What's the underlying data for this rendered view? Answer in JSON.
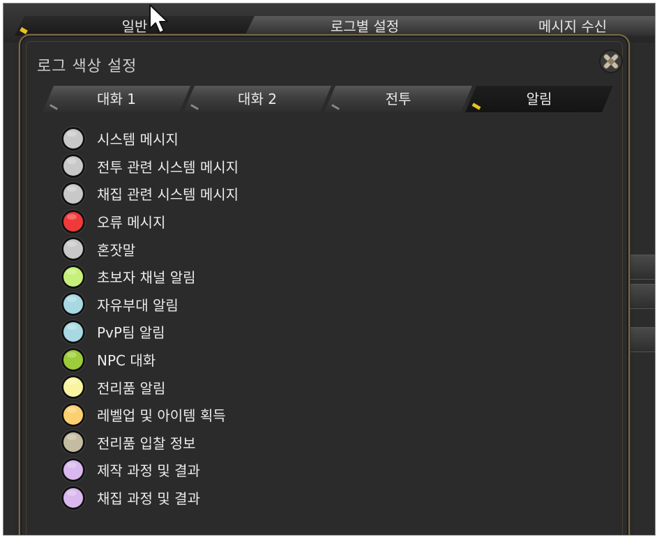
{
  "background_window": {
    "tabs": [
      {
        "label": "일반",
        "active": true
      },
      {
        "label": "로그별 설정",
        "active": false
      },
      {
        "label": "메시지 수신",
        "active": false
      }
    ]
  },
  "dialog": {
    "title": "로그 색상 설정",
    "close_icon": "close-icon",
    "tabs": [
      {
        "label": "대화 1",
        "active": false
      },
      {
        "label": "대화 2",
        "active": false
      },
      {
        "label": "전투",
        "active": false
      },
      {
        "label": "알림",
        "active": true
      }
    ],
    "items": [
      {
        "label": "시스템 메시지",
        "color": "#c8c8c8"
      },
      {
        "label": "전투 관련 시스템 메시지",
        "color": "#c8c8c8"
      },
      {
        "label": "채집 관련 시스템 메시지",
        "color": "#c8c8c8"
      },
      {
        "label": "오류 메시지",
        "color": "#f03a3a"
      },
      {
        "label": "혼잣말",
        "color": "#c8c8c8"
      },
      {
        "label": "초보자 채널 알림",
        "color": "#c6f07a"
      },
      {
        "label": "자유부대 알림",
        "color": "#a8d8e2"
      },
      {
        "label": "PvP팀 알림",
        "color": "#a8d8e2"
      },
      {
        "label": "NPC 대화",
        "color": "#9ccc3a"
      },
      {
        "label": "전리품 알림",
        "color": "#f8f4a0"
      },
      {
        "label": "레벨업 및 아이템 획득",
        "color": "#fcd070"
      },
      {
        "label": "전리품 입찰 정보",
        "color": "#c4bca0"
      },
      {
        "label": "제작 과정 및 결과",
        "color": "#d8b8ee"
      },
      {
        "label": "채집 과정 및 결과",
        "color": "#d8b8ee"
      }
    ]
  },
  "colors": {
    "frame_gold": "#7a6a4a",
    "tab_marker": "#e8c21e",
    "panel_bg": "#2b2b2b"
  }
}
